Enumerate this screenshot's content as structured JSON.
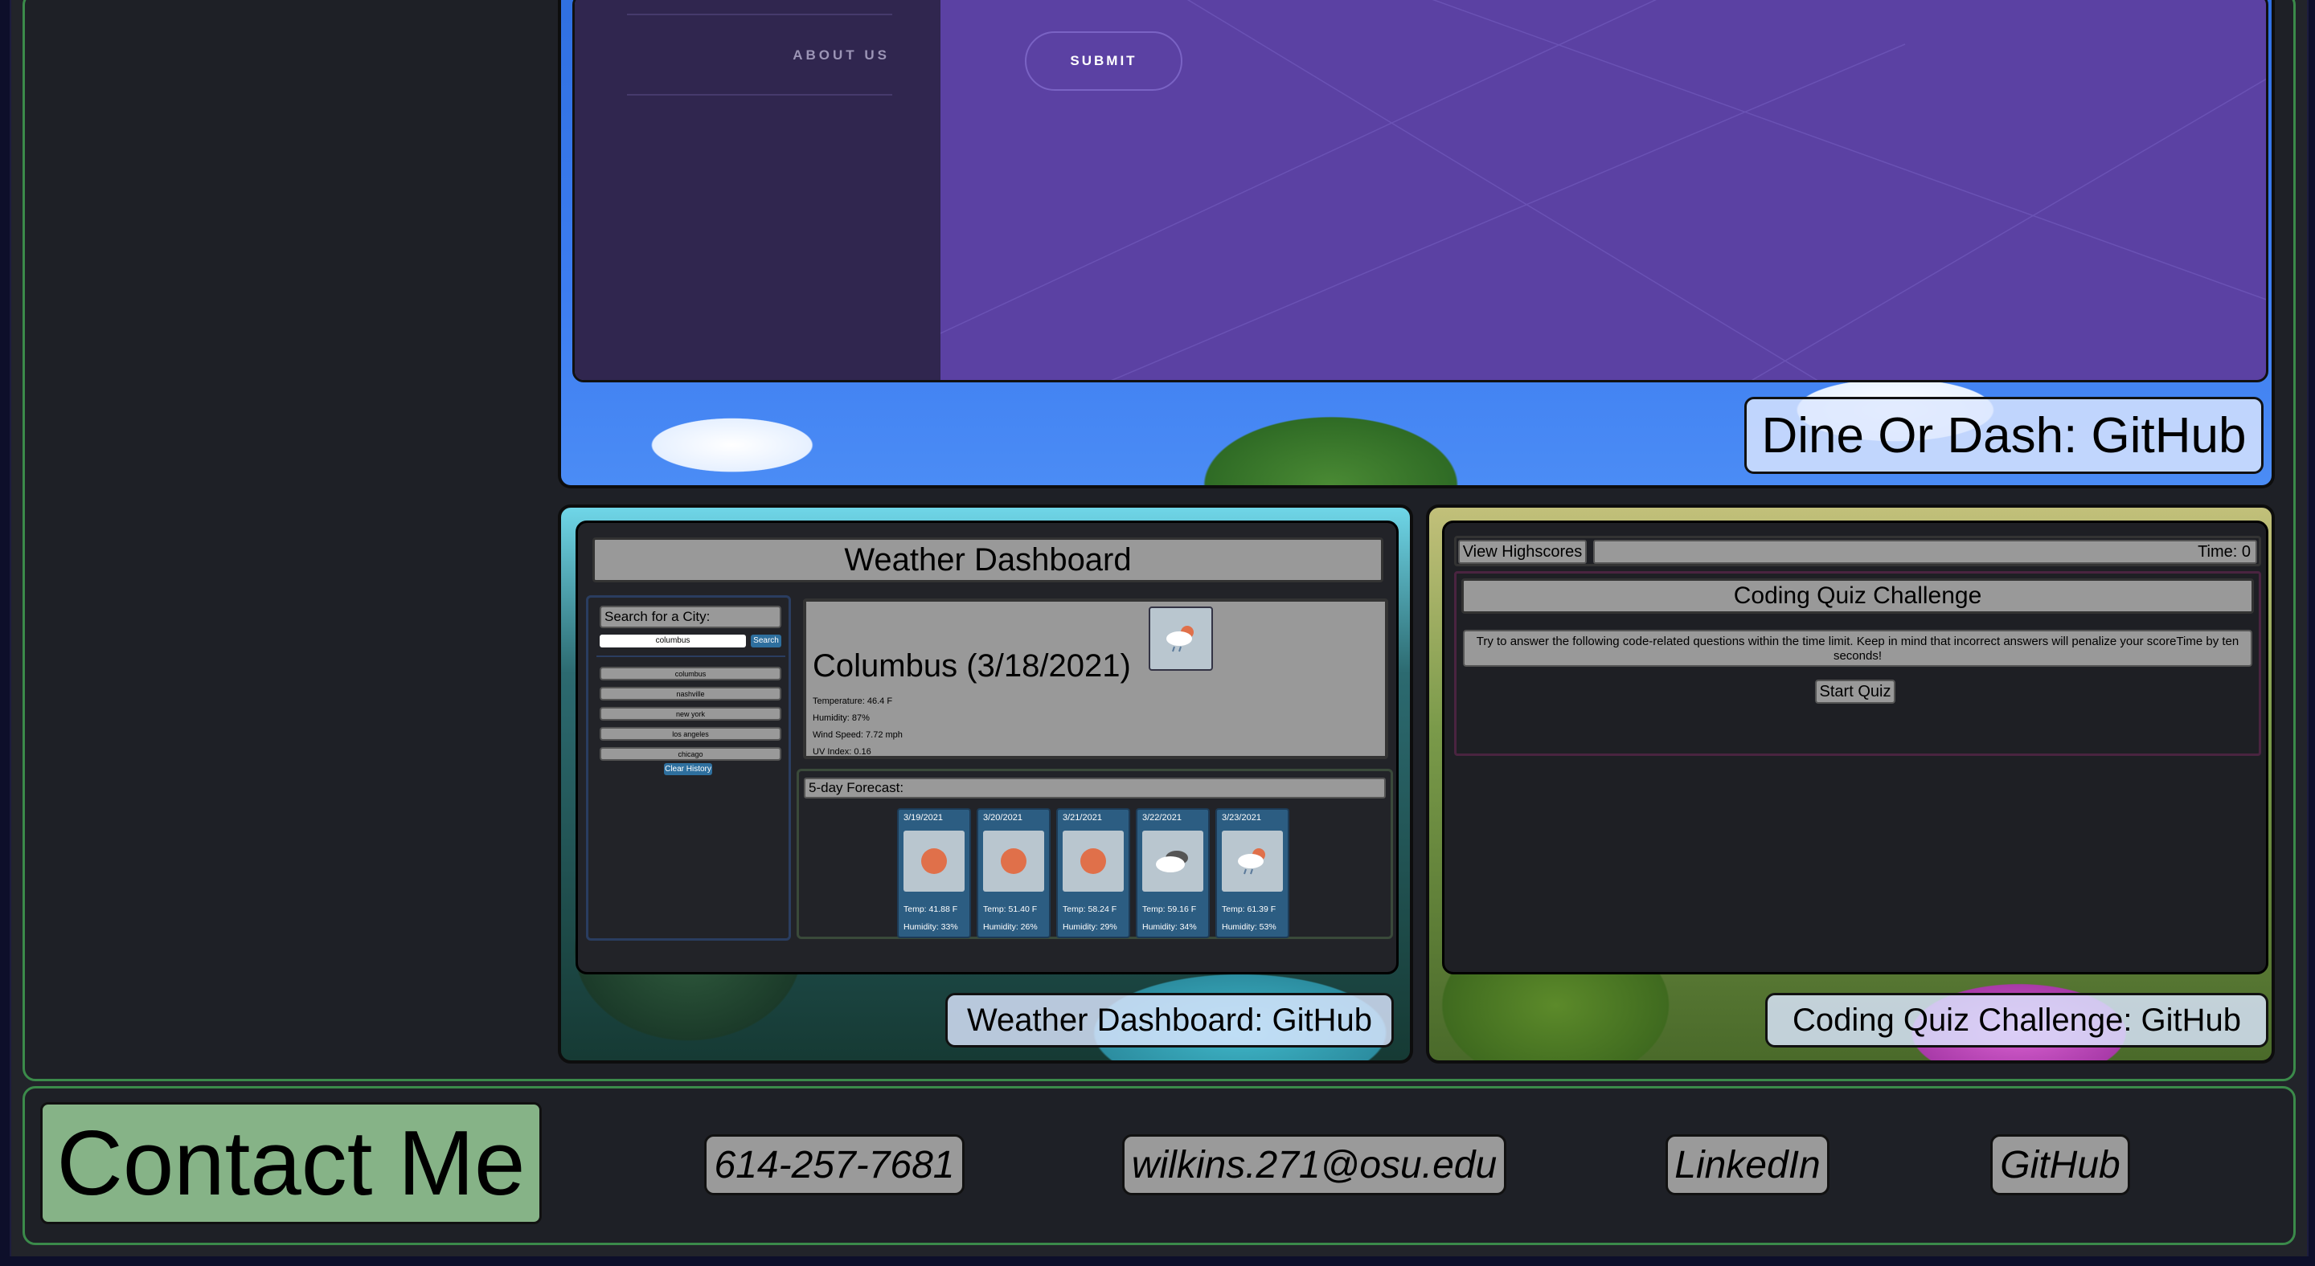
{
  "projects": {
    "dine": {
      "nav_about": "ABOUT US",
      "submit_label": "SUBMIT",
      "link_label": "Dine Or Dash: GitHub"
    },
    "weather": {
      "title": "Weather Dashboard",
      "search_label": "Search for a City:",
      "search_value": "columbus",
      "search_button": "Search",
      "history": [
        "columbus",
        "nashville",
        "new york",
        "los angeles",
        "chicago"
      ],
      "clear_button": "Clear History",
      "current": {
        "city_date": "Columbus (3/18/2021)",
        "icon": "rain-cloud-icon",
        "temperature": "Temperature: 46.4 F",
        "humidity": "Humidity: 87%",
        "wind": "Wind Speed: 7.72 mph",
        "uv": "UV Index: 0.16"
      },
      "forecast_label": "5-day Forecast:",
      "forecast": [
        {
          "date": "3/19/2021",
          "icon": "sun-icon",
          "temp": "Temp: 41.88 F",
          "humidity": "Humidity: 33%"
        },
        {
          "date": "3/20/2021",
          "icon": "sun-icon",
          "temp": "Temp: 51.40 F",
          "humidity": "Humidity: 26%"
        },
        {
          "date": "3/21/2021",
          "icon": "sun-icon",
          "temp": "Temp: 58.24 F",
          "humidity": "Humidity: 29%"
        },
        {
          "date": "3/22/2021",
          "icon": "cloud-icon",
          "temp": "Temp: 59.16 F",
          "humidity": "Humidity: 34%"
        },
        {
          "date": "3/23/2021",
          "icon": "rain-cloud-icon",
          "temp": "Temp: 61.39 F",
          "humidity": "Humidity: 53%"
        }
      ],
      "link_label": "Weather Dashboard: GitHub"
    },
    "quiz": {
      "highscores": "View Highscores",
      "time": "Time: 0",
      "title": "Coding Quiz Challenge",
      "description": "Try to answer the following code-related questions within the time limit. Keep in mind that incorrect answers will penalize your scoreTime by ten seconds!",
      "start_button": "Start Quiz",
      "link_label": "Coding Quiz Challenge: GitHub"
    }
  },
  "contact": {
    "heading": "Contact Me",
    "phone": "614-257-7681",
    "email": "wilkins.271@osu.edu",
    "linkedin": "LinkedIn",
    "github": "GitHub"
  },
  "colors": {
    "border_green": "#3b8a4a",
    "contact_heading_bg": "#86b387",
    "dine_purple": "#5b41a3"
  }
}
